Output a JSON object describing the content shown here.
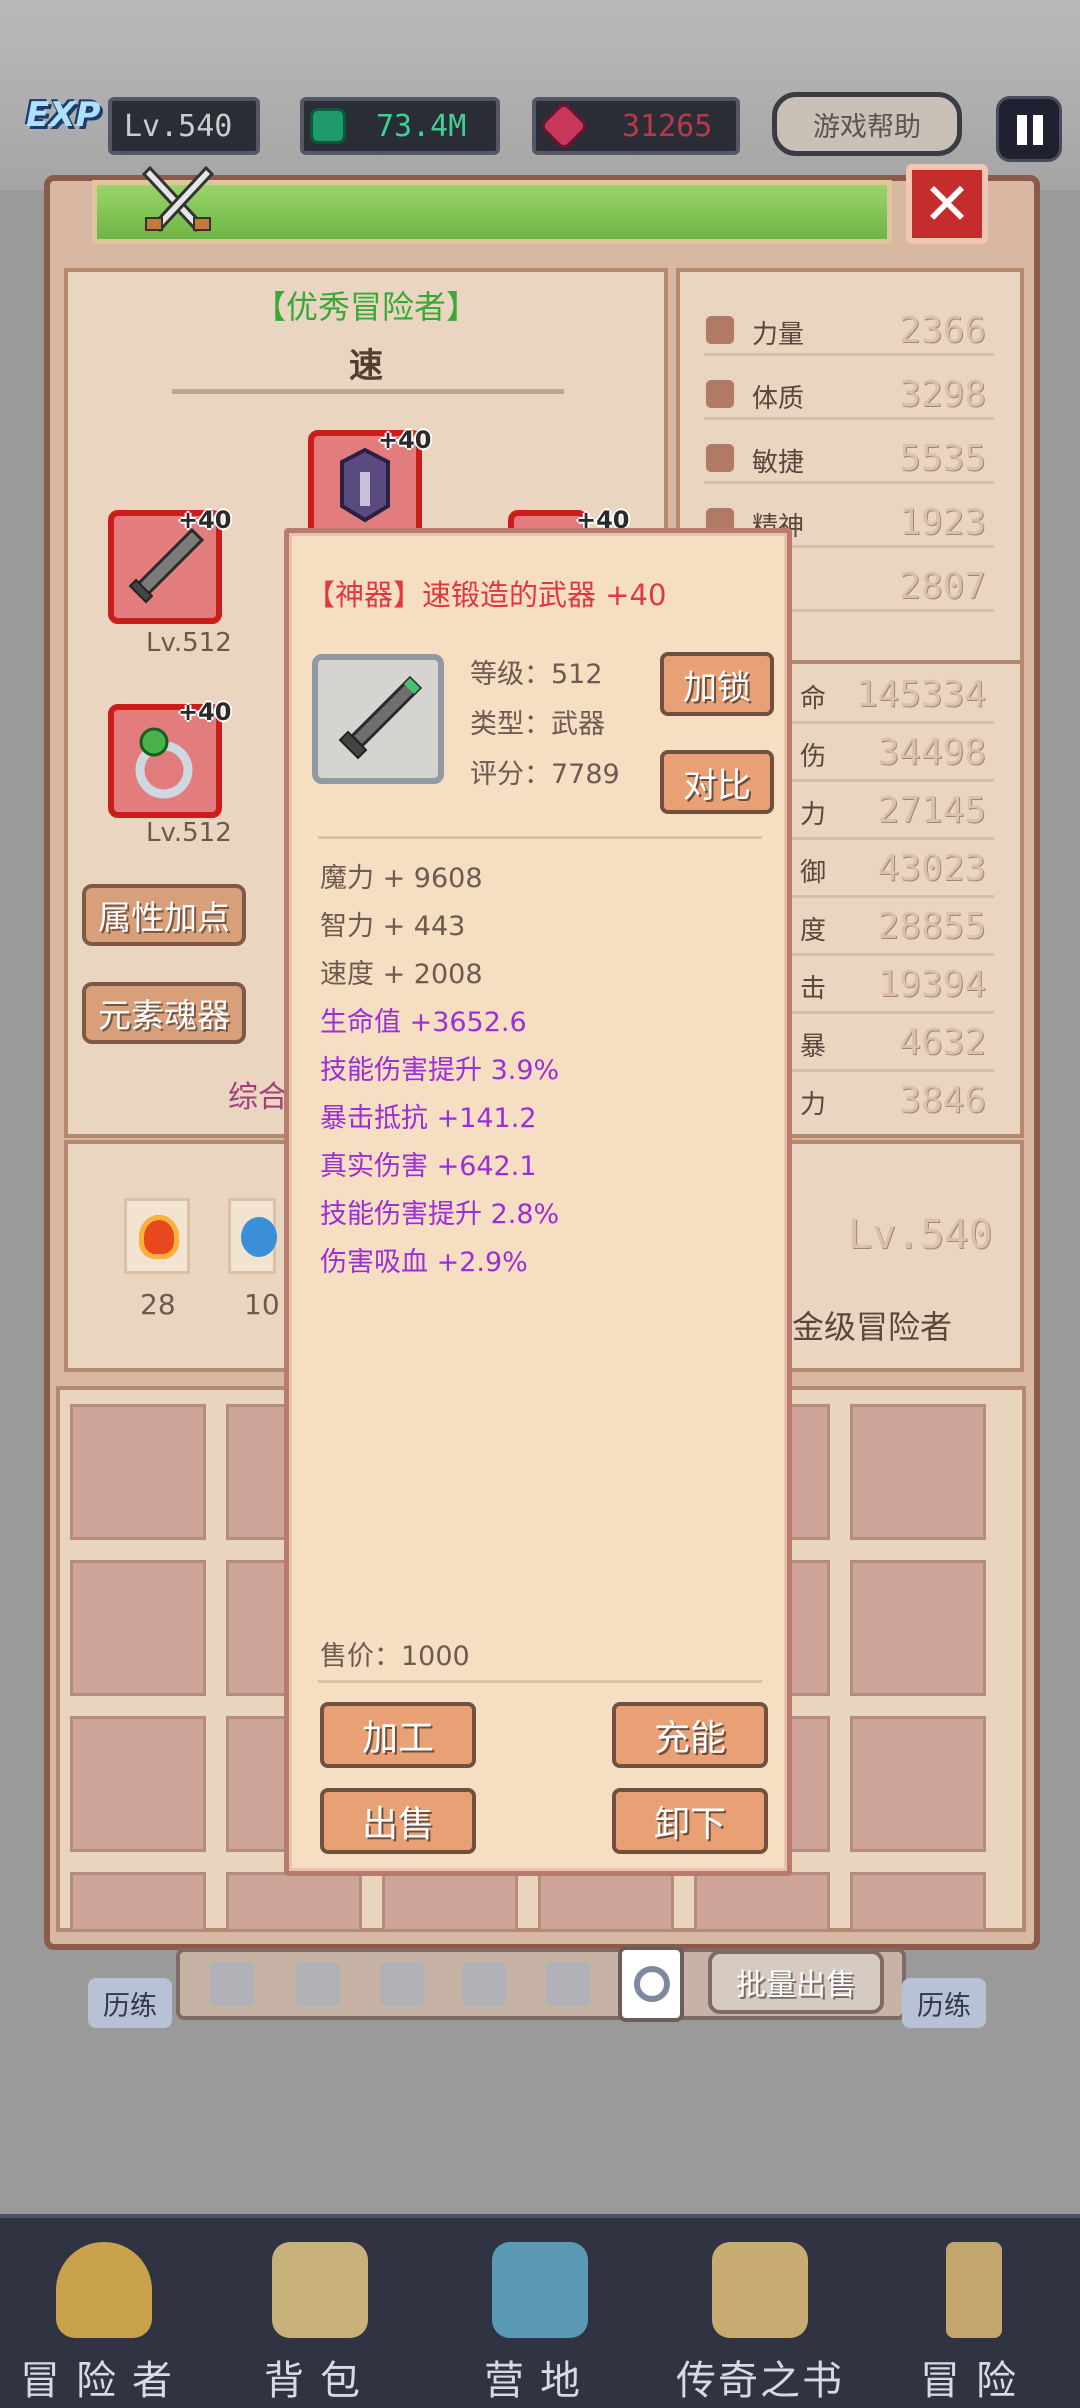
{
  "topbar": {
    "level": "Lv.540",
    "exp_badge": "EXP",
    "currency_green": "73.4M",
    "currency_red": "31265",
    "help_label": "游戏帮助"
  },
  "character": {
    "title": "【优秀冒险者】",
    "class": "速",
    "slots": [
      {
        "plus": "+40",
        "level": "Lv.512"
      },
      {
        "plus": "+40"
      },
      {
        "plus": "+40",
        "level": "Lv.512"
      },
      {
        "plus": "+40"
      }
    ],
    "buttons": [
      "属性加点",
      "元素魂器"
    ],
    "overall_fragment": "综合"
  },
  "stats": [
    {
      "name": "力量",
      "value": "2366"
    },
    {
      "name": "体质",
      "value": "3298"
    },
    {
      "name": "敏捷",
      "value": "5535"
    },
    {
      "name": "精神",
      "value": "1923"
    },
    {
      "name": "力",
      "value": "2807"
    }
  ],
  "combat_stats": [
    {
      "name": "命",
      "value": "145334"
    },
    {
      "name": "伤",
      "value": "34498"
    },
    {
      "name": "力",
      "value": "27145"
    },
    {
      "name": "御",
      "value": "43023"
    },
    {
      "name": "度",
      "value": "28855"
    },
    {
      "name": "击",
      "value": "19394"
    },
    {
      "name": "暴",
      "value": "4632"
    },
    {
      "name": "力",
      "value": "3846"
    }
  ],
  "bottom_card": {
    "item1_count": "28",
    "item2_count": "10",
    "player_level": "Lv.540",
    "player_rank": "金级冒险者"
  },
  "tabs": {
    "train_left": "历练",
    "train_right": "历练",
    "batch_sell": "批量出售"
  },
  "popup": {
    "title": "【神器】速锻造的武器 +40",
    "level_line": "等级：512",
    "type_line": "类型：武器",
    "score_line": "评分：7789",
    "lock_label": "加锁",
    "compare_label": "对比",
    "base_attrs": [
      "魔力 + 9608",
      "智力 + 443",
      "速度 + 2008"
    ],
    "extra_attrs": [
      "生命值 +3652.6",
      "技能伤害提升 3.9%",
      "暴击抵抗 +141.2",
      "真实伤害 +642.1",
      "技能伤害提升 2.8%",
      "伤害吸血 +2.9%"
    ],
    "price_line": "售价：1000",
    "actions": [
      "加工",
      "充能",
      "出售",
      "卸下"
    ]
  },
  "nav": [
    {
      "label": "冒险者"
    },
    {
      "label": "背包"
    },
    {
      "label": "营地"
    },
    {
      "label": "传奇之书"
    },
    {
      "label": "冒险"
    }
  ],
  "colors": {
    "legendary_red": "#e1373f",
    "extra_purple": "#9b2fd6",
    "title_green": "#3aa838"
  }
}
